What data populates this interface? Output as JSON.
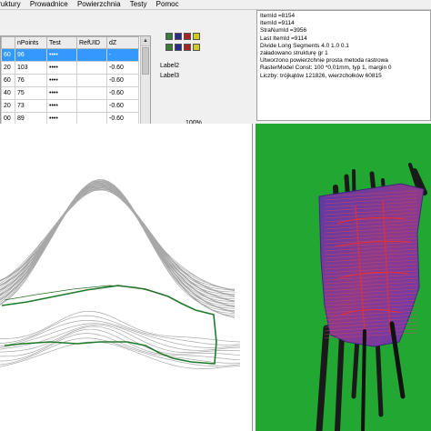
{
  "menu": {
    "items": [
      "truktury",
      "Prowadnice",
      "Powierzchnia",
      "Testy",
      "Pomoc"
    ]
  },
  "table": {
    "headers": [
      "",
      "nPoints",
      "Test",
      "RefUID",
      "dZ"
    ],
    "rows": [
      [
        "60",
        "96",
        "••••",
        "",
        "-"
      ],
      [
        "20",
        "103",
        "••••",
        "",
        "-0.60"
      ],
      [
        "60",
        "76",
        "••••",
        "",
        "-0.60"
      ],
      [
        "40",
        "75",
        "••••",
        "",
        "-0.60"
      ],
      [
        "20",
        "73",
        "••••",
        "",
        "-0.60"
      ],
      [
        "00",
        "89",
        "••••",
        "",
        "-0.60"
      ]
    ],
    "selected_row": 0
  },
  "swatch_colors": [
    "#3a7a3a",
    "#2a2a8a",
    "#aa2222",
    "#cccc22",
    "#3a7a3a",
    "#2a2a8a",
    "#aa2222",
    "#cccc22"
  ],
  "labels": {
    "label2": "Label2",
    "label3": "Label3",
    "percent": "100%"
  },
  "log": [
    "ItemId =8154",
    "ItemId =9114",
    "StraNumId =3956",
    "Last ItemId =9114",
    "Divide Long Segments 4.0 1.0 0.1",
    "załadowano strukturę gr 1",
    "Utworzono powierzchnie prosta metoda rastrowa",
    "RasterModel Const: 100 *0,01mm, typ 1, margin 0",
    "Liczby: trójkątów 121826, wierzchołków 60815"
  ],
  "colors": {
    "viewport_3d_background": "#22a832",
    "selection": "#3399ff",
    "contour": "#1e7a2a"
  }
}
